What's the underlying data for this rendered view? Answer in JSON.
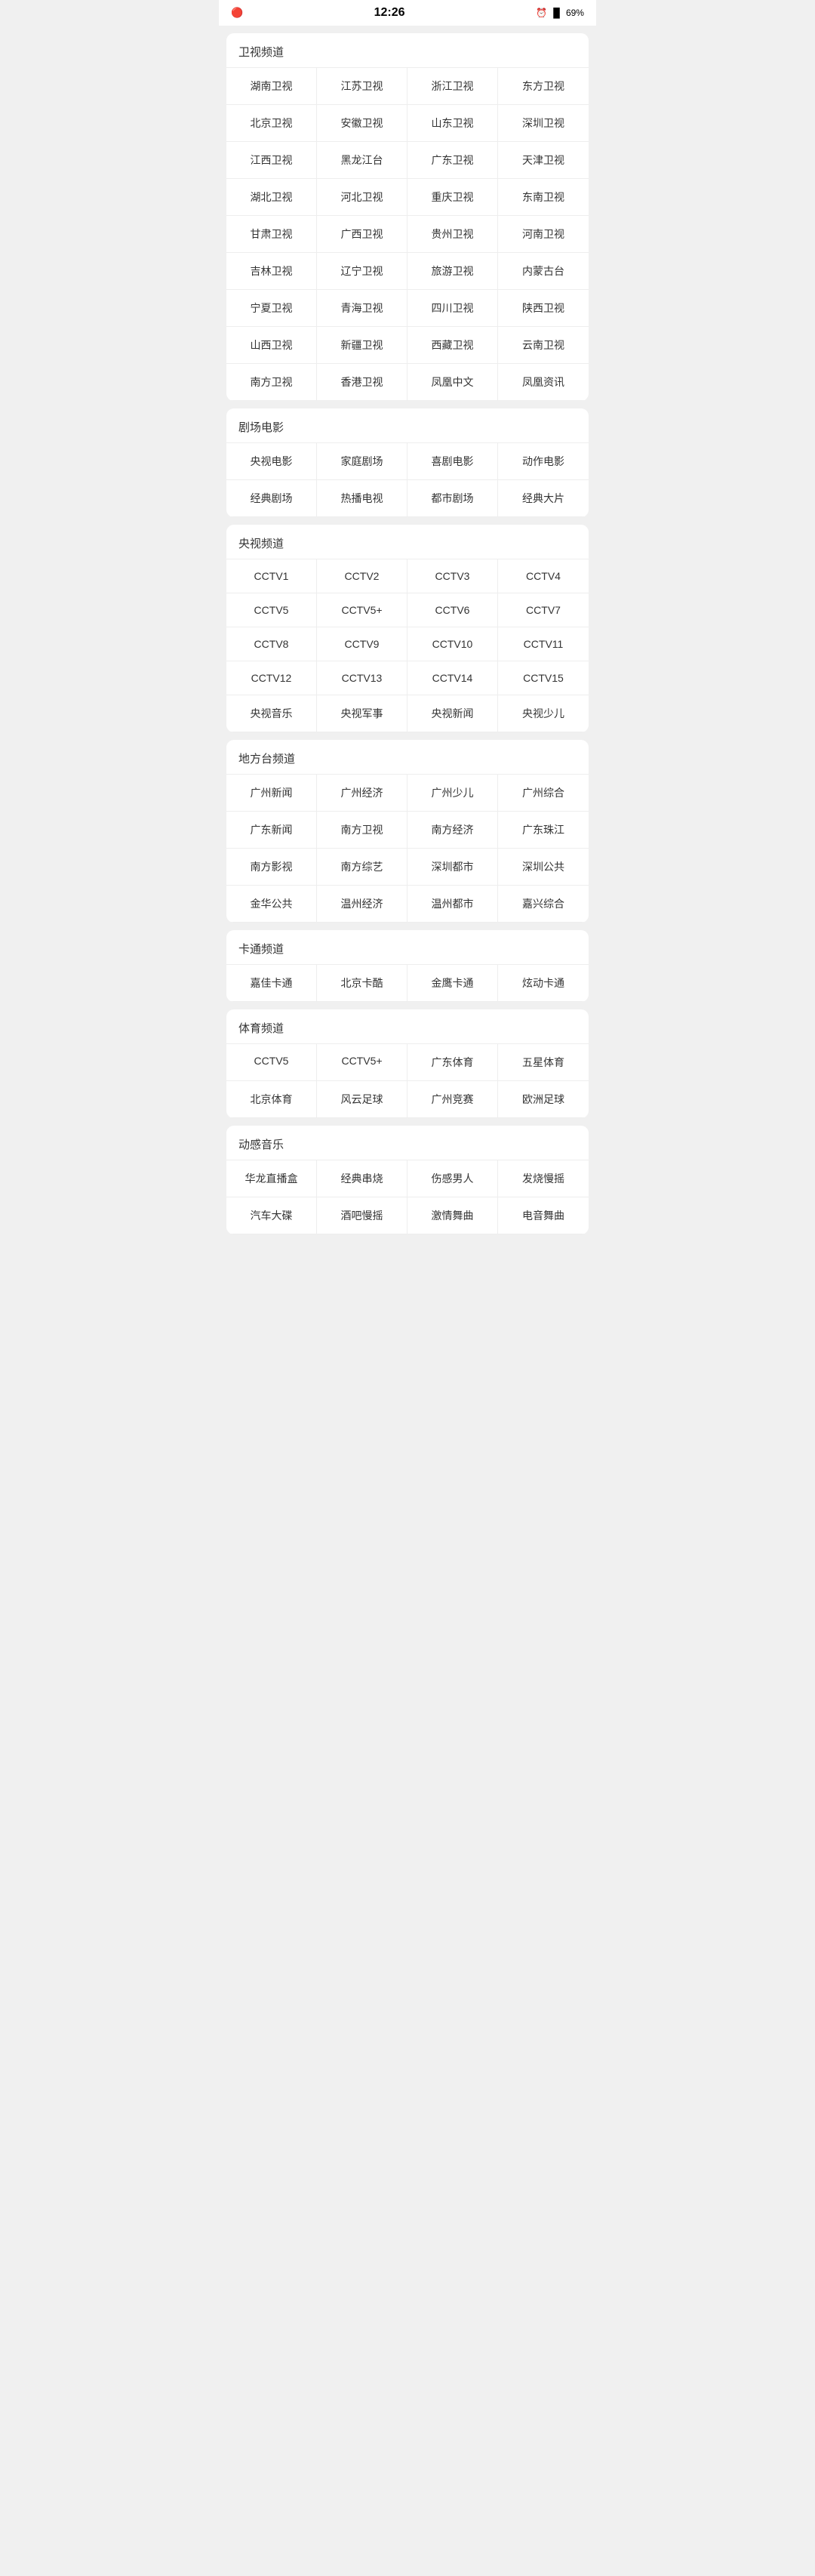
{
  "statusBar": {
    "time": "12:26",
    "battery": "69%"
  },
  "sections": [
    {
      "id": "satellite",
      "title": "卫视频道",
      "channels": [
        "湖南卫视",
        "江苏卫视",
        "浙江卫视",
        "东方卫视",
        "北京卫视",
        "安徽卫视",
        "山东卫视",
        "深圳卫视",
        "江西卫视",
        "黑龙江台",
        "广东卫视",
        "天津卫视",
        "湖北卫视",
        "河北卫视",
        "重庆卫视",
        "东南卫视",
        "甘肃卫视",
        "广西卫视",
        "贵州卫视",
        "河南卫视",
        "吉林卫视",
        "辽宁卫视",
        "旅游卫视",
        "内蒙古台",
        "宁夏卫视",
        "青海卫视",
        "四川卫视",
        "陕西卫视",
        "山西卫视",
        "新疆卫视",
        "西藏卫视",
        "云南卫视",
        "南方卫视",
        "香港卫视",
        "凤凰中文",
        "凤凰资讯"
      ]
    },
    {
      "id": "theater",
      "title": "剧场电影",
      "channels": [
        "央视电影",
        "家庭剧场",
        "喜剧电影",
        "动作电影",
        "经典剧场",
        "热播电视",
        "都市剧场",
        "经典大片"
      ]
    },
    {
      "id": "cctv",
      "title": "央视频道",
      "channels": [
        "CCTV1",
        "CCTV2",
        "CCTV3",
        "CCTV4",
        "CCTV5",
        "CCTV5+",
        "CCTV6",
        "CCTV7",
        "CCTV8",
        "CCTV9",
        "CCTV10",
        "CCTV11",
        "CCTV12",
        "CCTV13",
        "CCTV14",
        "CCTV15",
        "央视音乐",
        "央视军事",
        "央视新闻",
        "央视少儿"
      ]
    },
    {
      "id": "local",
      "title": "地方台频道",
      "channels": [
        "广州新闻",
        "广州经济",
        "广州少儿",
        "广州综合",
        "广东新闻",
        "南方卫视",
        "南方经济",
        "广东珠江",
        "南方影视",
        "南方综艺",
        "深圳都市",
        "深圳公共",
        "金华公共",
        "温州经济",
        "温州都市",
        "嘉兴综合"
      ]
    },
    {
      "id": "cartoon",
      "title": "卡通频道",
      "channels": [
        "嘉佳卡通",
        "北京卡酷",
        "金鹰卡通",
        "炫动卡通"
      ]
    },
    {
      "id": "sports",
      "title": "体育频道",
      "channels": [
        "CCTV5",
        "CCTV5+",
        "广东体育",
        "五星体育",
        "北京体育",
        "风云足球",
        "广州竞赛",
        "欧洲足球"
      ]
    },
    {
      "id": "music",
      "title": "动感音乐",
      "channels": [
        "华龙直播盒",
        "经典串烧",
        "伤感男人",
        "发烧慢摇",
        "汽车大碟",
        "酒吧慢摇",
        "激情舞曲",
        "电音舞曲"
      ]
    }
  ]
}
